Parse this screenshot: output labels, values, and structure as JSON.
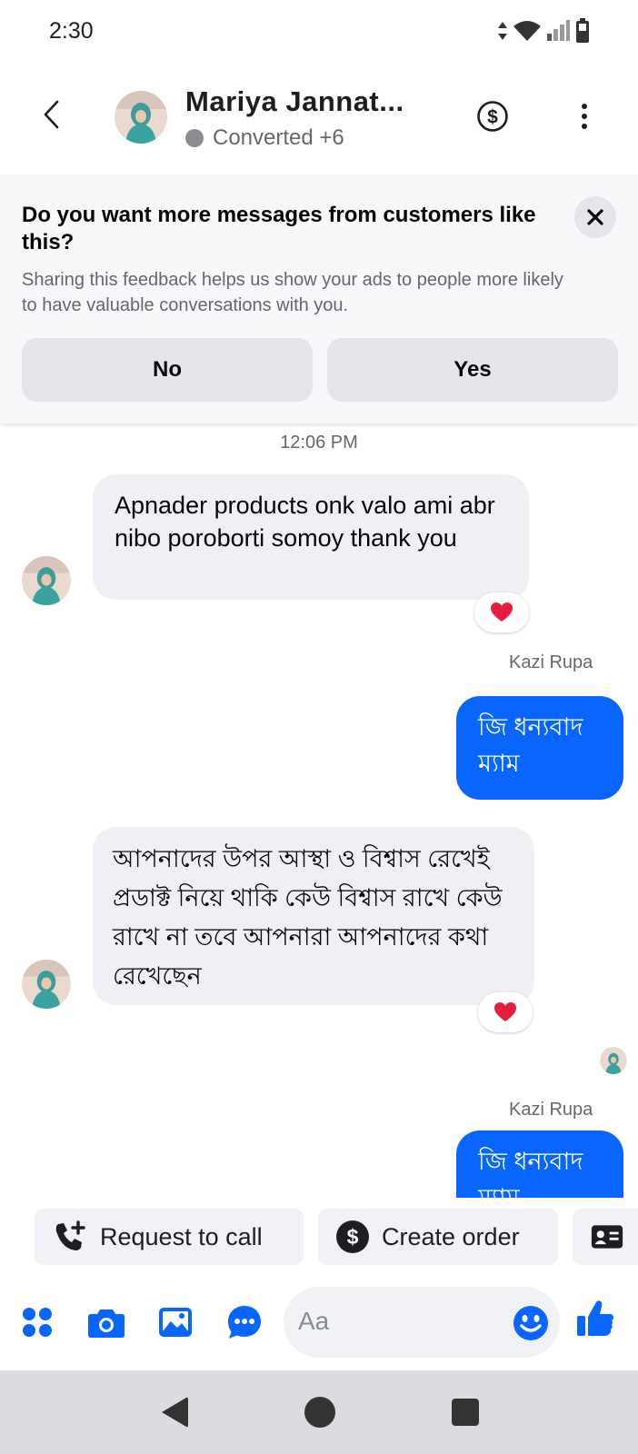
{
  "status_bar": {
    "time": "2:30"
  },
  "header": {
    "contact_name": "Mariya Jannat...",
    "status": "Converted +6"
  },
  "feedback": {
    "title": "Do you want more messages from customers like this?",
    "description": "Sharing this feedback helps us show your ads to people more likely to have valuable conversations with you.",
    "no_label": "No",
    "yes_label": "Yes"
  },
  "chat": {
    "timestamp": "12:06 PM",
    "messages": [
      {
        "direction": "incoming",
        "text": "Apnader products onk valo ami abr nibo poroborti somoy thank you",
        "reaction": "heart"
      },
      {
        "direction": "outgoing",
        "sender": "Kazi Rupa",
        "text": "জি ধন্যবাদ ম্যাম"
      },
      {
        "direction": "incoming",
        "text": "আপনাদের উপর আস্থা ও বিশ্বাস রেখেই প্রডাক্ট নিয়ে থাকি কেউ বিশ্বাস রাখে কেউ রাখে না তবে আপনারা আপনাদের কথা রেখেছেন",
        "reaction": "heart"
      },
      {
        "direction": "outgoing",
        "sender": "Kazi Rupa",
        "text": "জি ধন্যবাদ ম্যাম"
      }
    ]
  },
  "quick_actions": {
    "request_call": "Request to call",
    "create_order": "Create order"
  },
  "composer": {
    "placeholder": "Aa"
  },
  "colors": {
    "accent": "#0866ff",
    "incoming_bubble": "#eff0f3",
    "reaction_heart": "#e41e3f"
  }
}
